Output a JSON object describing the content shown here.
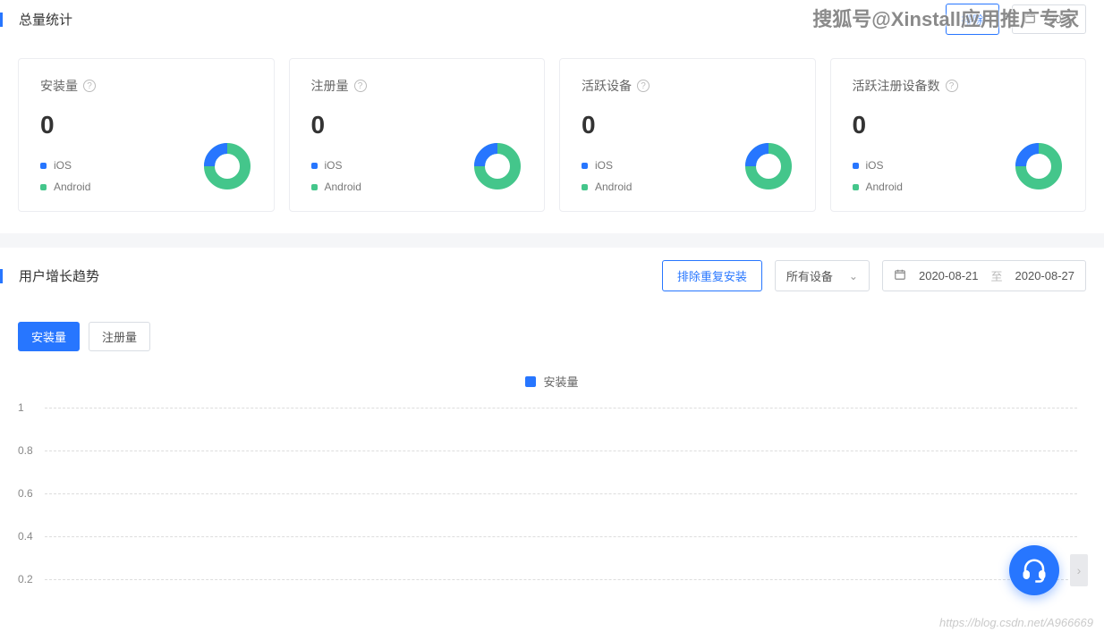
{
  "watermarks": {
    "top": "搜狐号@Xinstall应用推广专家",
    "bottom": "https://blog.csdn.net/A966669"
  },
  "totals": {
    "title": "总量统计",
    "exclude_btn": "排除",
    "date_from": "2020",
    "cards": [
      {
        "title": "安装量",
        "value": "0",
        "legend_ios": "iOS",
        "legend_android": "Android"
      },
      {
        "title": "注册量",
        "value": "0",
        "legend_ios": "iOS",
        "legend_android": "Android"
      },
      {
        "title": "活跃设备",
        "value": "0",
        "legend_ios": "iOS",
        "legend_android": "Android"
      },
      {
        "title": "活跃注册设备数",
        "value": "0",
        "legend_ios": "iOS",
        "legend_android": "Android"
      }
    ]
  },
  "growth": {
    "title": "用户增长趋势",
    "exclude_btn": "排除重复安装",
    "device_select": "所有设备",
    "date_from": "2020-08-21",
    "date_to": "2020-08-27",
    "date_sep": "至",
    "tabs": {
      "install": "安装量",
      "register": "注册量"
    },
    "chart_legend": "安装量"
  },
  "chart_data": {
    "type": "line",
    "title": "",
    "xlabel": "",
    "ylabel": "",
    "ylim": [
      0,
      1
    ],
    "yticks": [
      1,
      0.8,
      0.6,
      0.4,
      0.2
    ],
    "series": [
      {
        "name": "安装量",
        "values": []
      }
    ],
    "categories": []
  }
}
